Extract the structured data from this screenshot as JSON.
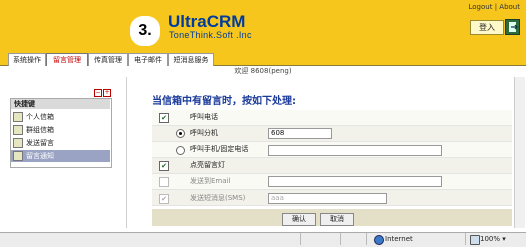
{
  "header": {
    "logo_number": "3.",
    "brand": "UltraCRM",
    "brand_sub": "ToneThink.Soft .Inc",
    "logout": "Logout",
    "about": "About",
    "separator": "|",
    "login": "登入"
  },
  "tabs": [
    {
      "label": "系统操作",
      "active": false
    },
    {
      "label": "留言管理",
      "active": true
    },
    {
      "label": "传真管理",
      "active": false
    },
    {
      "label": "电子邮件",
      "active": false
    },
    {
      "label": "短消息服务",
      "active": false
    }
  ],
  "welcome": "欢迎 8608(peng)",
  "quick": {
    "minus": "−",
    "plus": "+",
    "title": "快捷键",
    "items": [
      {
        "label": "个人信箱",
        "selected": false
      },
      {
        "label": "群组信箱",
        "selected": false
      },
      {
        "label": "发送留言",
        "selected": false
      },
      {
        "label": "留言通知",
        "selected": true
      }
    ]
  },
  "main": {
    "title": "当信箱中有留言时，按如下处理:",
    "rows": {
      "call": {
        "label": "呼叫电话",
        "checked": true
      },
      "ext": {
        "label": "呼叫分机",
        "value": "608",
        "selected": true
      },
      "mobile": {
        "label": "呼叫手机/固定电话",
        "value": "",
        "selected": false
      },
      "lamp": {
        "label": "点亮留言灯",
        "checked": true
      },
      "email": {
        "label": "发送到Email",
        "value": "",
        "checked": false
      },
      "sms": {
        "label": "发送短消息(SMS)",
        "value": "aaa",
        "checked": true
      }
    },
    "ok": "确认",
    "cancel": "取消",
    "check_mark": "✔"
  },
  "status": {
    "zone": "Internet",
    "zoom": "100%",
    "zoom_arrow": "▾"
  },
  "colors": {
    "header_bg": "#f6c61c",
    "brand": "#003c9d",
    "title": "#1a3a9a",
    "selected_item": "#9aa3c4"
  }
}
